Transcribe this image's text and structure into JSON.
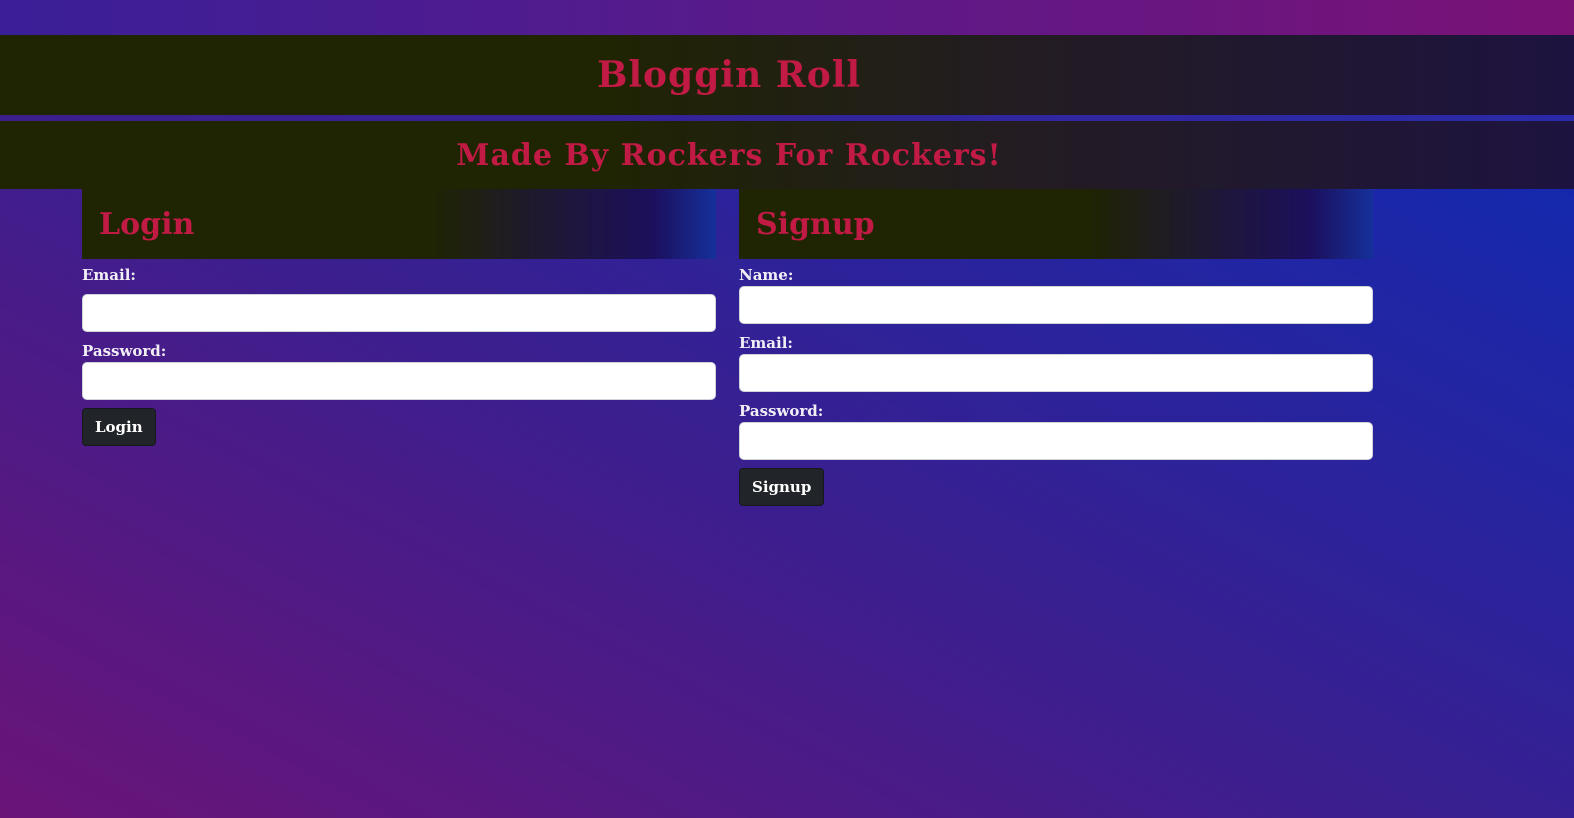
{
  "header": {
    "title": "Bloggin Roll",
    "subtitle": "Made By Rockers For Rockers!"
  },
  "login": {
    "heading": "Login",
    "email_label": "Email:",
    "password_label": "Password:",
    "email_value": "",
    "password_value": "",
    "submit_label": "Login"
  },
  "signup": {
    "heading": "Signup",
    "name_label": "Name:",
    "email_label": "Email:",
    "password_label": "Password:",
    "name_value": "",
    "email_value": "",
    "password_value": "",
    "submit_label": "Signup"
  },
  "colors": {
    "heading_red": "#c01a45",
    "button_dark": "#212529",
    "banner_olive": "#1f2402"
  }
}
